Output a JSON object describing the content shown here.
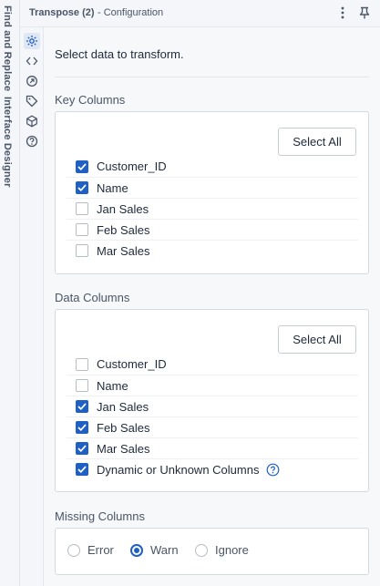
{
  "left_rail": {
    "tabs": [
      "Find and Replace",
      "Interface Designer"
    ]
  },
  "header": {
    "title": "Transpose (2)",
    "subtitle": "- Configuration"
  },
  "toolbar_icons": [
    "gear-icon",
    "code-icon",
    "target-icon",
    "tag-icon",
    "cube-icon",
    "help-icon"
  ],
  "intro": "Select data to transform.",
  "key_columns": {
    "title": "Key Columns",
    "select_all_label": "Select All",
    "items": [
      {
        "label": "Customer_ID",
        "checked": true
      },
      {
        "label": "Name",
        "checked": true
      },
      {
        "label": "Jan Sales",
        "checked": false
      },
      {
        "label": "Feb Sales",
        "checked": false
      },
      {
        "label": "Mar Sales",
        "checked": false
      }
    ]
  },
  "data_columns": {
    "title": "Data Columns",
    "select_all_label": "Select All",
    "items": [
      {
        "label": "Customer_ID",
        "checked": false
      },
      {
        "label": "Name",
        "checked": false
      },
      {
        "label": "Jan Sales",
        "checked": true
      },
      {
        "label": "Feb Sales",
        "checked": true
      },
      {
        "label": "Mar Sales",
        "checked": true
      },
      {
        "label": "Dynamic or Unknown Columns",
        "checked": true
      }
    ]
  },
  "missing_columns": {
    "title": "Missing Columns",
    "options": [
      {
        "label": "Error",
        "selected": false
      },
      {
        "label": "Warn",
        "selected": true
      },
      {
        "label": "Ignore",
        "selected": false
      }
    ]
  },
  "colors": {
    "accent": "#1f60c4",
    "text": "#1e2a3a",
    "muted": "#4a5566",
    "panel": "#f7f8fa",
    "border": "#d4d9e0"
  }
}
